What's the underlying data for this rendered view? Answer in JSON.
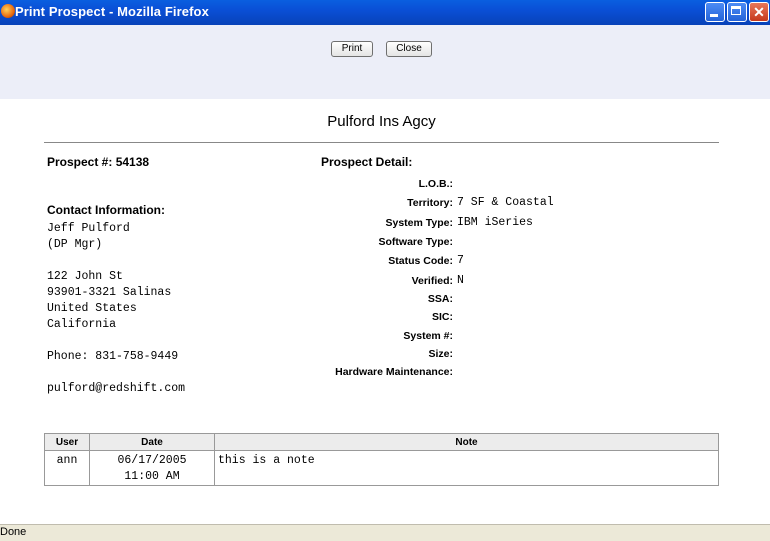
{
  "window": {
    "title": "Print Prospect - Mozilla Firefox"
  },
  "toolbar": {
    "print_label": "Print",
    "close_label": "Close"
  },
  "page": {
    "heading": "Pulford Ins Agcy"
  },
  "prospect": {
    "number_label": "Prospect #: 54138",
    "contact_heading": "Contact Information:",
    "contact_name": "Jeff Pulford",
    "contact_title": "(DP Mgr)",
    "address_lines": [
      "122 John St",
      "93901-3321 Salinas",
      "United States",
      "California"
    ],
    "phone": "Phone: 831-758-9449",
    "email": "pulford@redshift.com"
  },
  "detail": {
    "heading": "Prospect Detail:",
    "fields": [
      {
        "label": "L.O.B.:",
        "value": ""
      },
      {
        "label": "Territory:",
        "value": "7 SF & Coastal"
      },
      {
        "label": "System Type:",
        "value": "IBM iSeries"
      },
      {
        "label": "Software Type:",
        "value": ""
      },
      {
        "label": "Status Code:",
        "value": "7"
      },
      {
        "label": "Verified:",
        "value": "N"
      },
      {
        "label": "SSA:",
        "value": ""
      },
      {
        "label": "SIC:",
        "value": ""
      },
      {
        "label": "System #:",
        "value": ""
      },
      {
        "label": "Size:",
        "value": ""
      },
      {
        "label": "Hardware Maintenance:",
        "value": ""
      }
    ]
  },
  "notes": {
    "headers": [
      "User",
      "Date",
      "Note"
    ],
    "rows": [
      {
        "user": "ann",
        "date": "06/17/2005",
        "time": "11:00 AM",
        "note": "this is a note"
      }
    ]
  },
  "statusbar": {
    "text": "Done"
  }
}
